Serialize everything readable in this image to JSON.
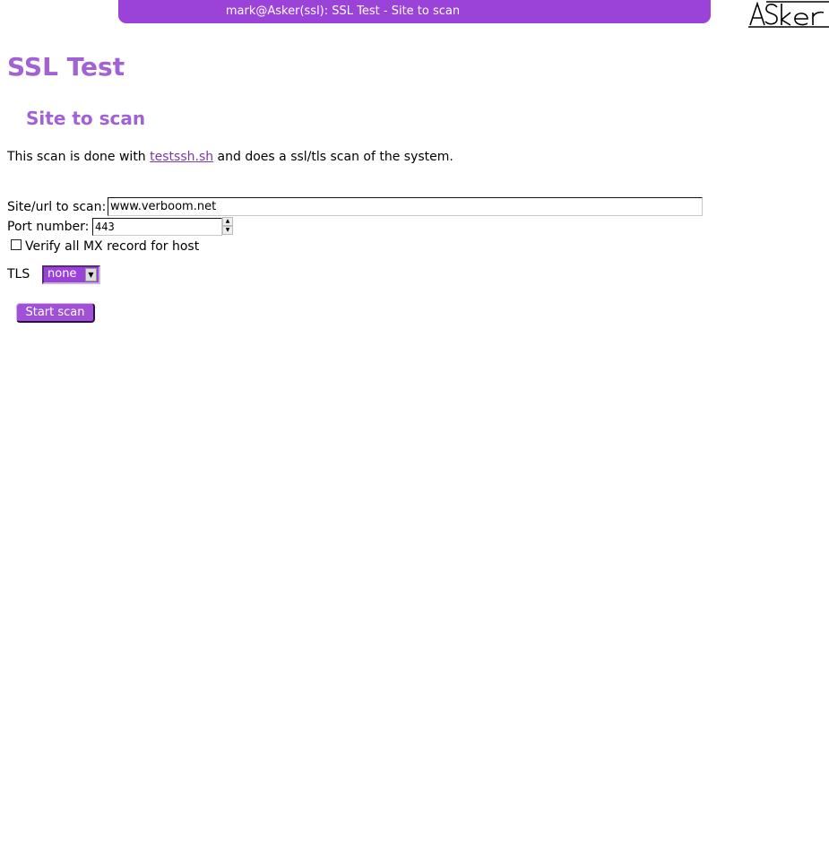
{
  "window": {
    "title": "mark@Asker(ssl): SSL Test - Site to scan"
  },
  "logo": {
    "text": "ASker",
    "icon": "asker-logo-icon"
  },
  "page": {
    "heading": "SSL Test",
    "subheading": "Site to scan"
  },
  "intro": {
    "before_link": "This scan is done with ",
    "link_text": "testssh.sh",
    "after_link": " and does a ssl/tls scan of the system."
  },
  "form": {
    "site_label": "Site/url to scan:",
    "site_value": "www.verboom.net",
    "port_label": "Port number:",
    "port_value": "443",
    "mx_checked": false,
    "mx_label": "Verify all MX record for host",
    "tls_label": "TLS",
    "tls_selected": "none",
    "start_button": "Start scan"
  },
  "colors": {
    "accent": "#9b42d8",
    "heading": "#a261d4",
    "link": "#7a3aa8"
  }
}
